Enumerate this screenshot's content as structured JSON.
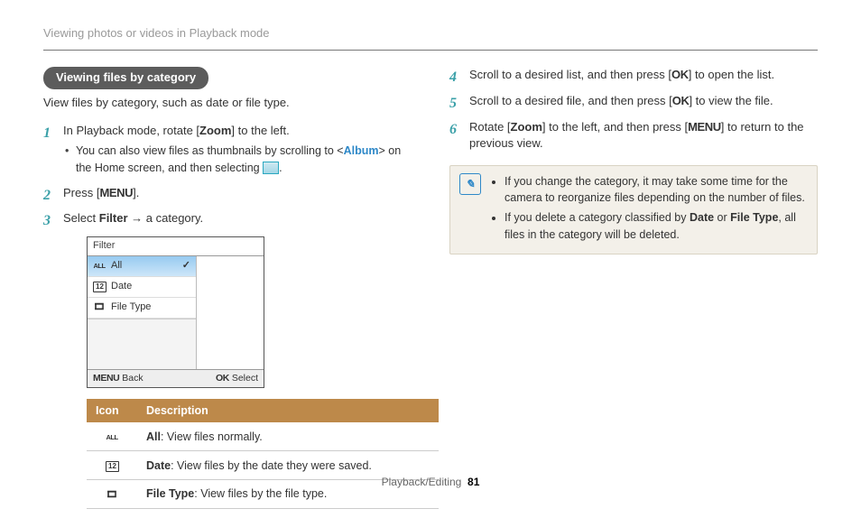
{
  "header": "Viewing photos or videos in Playback mode",
  "section_pill": "Viewing files by category",
  "intro": "View files by category, such as date or file type.",
  "steps": {
    "s1": {
      "text_pre": "In Playback mode, rotate [",
      "zoom": "Zoom",
      "text_post": "] to the left."
    },
    "s1_sub": {
      "pre": "You can also view files as thumbnails by scrolling to <",
      "album": "Album",
      "post": "> on the Home screen, and then selecting "
    },
    "s2": {
      "pre": "Press [",
      "menu": "MENU",
      "post": "]."
    },
    "s3": {
      "pre": "Select ",
      "filter": "Filter",
      "arrow": " → ",
      "post": "a category."
    },
    "s4": {
      "pre": "Scroll to a desired list, and then press [",
      "ok": "OK",
      "post": "] to open the list."
    },
    "s5": {
      "pre": "Scroll to a desired file, and then press [",
      "ok": "OK",
      "post": "] to view the file."
    },
    "s6": {
      "pre": "Rotate [",
      "zoom": "Zoom",
      "mid": "] to the left, and then press [",
      "menu": "MENU",
      "post": "] to return to the previous view."
    }
  },
  "filter_menu": {
    "title": "Filter",
    "items": {
      "all": "All",
      "date": "Date",
      "filetype": "File Type"
    },
    "footer": {
      "back_key": "MENU",
      "back": "Back",
      "select_key": "OK",
      "select": "Select"
    }
  },
  "table": {
    "head_icon": "Icon",
    "head_desc": "Description",
    "rows": {
      "all": {
        "term": "All",
        "desc": ": View files normally."
      },
      "date": {
        "term": "Date",
        "desc": ": View files by the date they were saved."
      },
      "ft": {
        "term": "File Type",
        "desc": ": View files by the file type."
      }
    }
  },
  "note": {
    "n1_a": "If you change the category, it may take some time for the camera to reorganize files depending on the number of files.",
    "n2_a": "If you delete a category classified by ",
    "n2_date": "Date",
    "n2_or": " or ",
    "n2_ft": "File Type",
    "n2_b": ", all files in the category will be deleted."
  },
  "footer": {
    "section": "Playback/Editing",
    "page": "81"
  }
}
